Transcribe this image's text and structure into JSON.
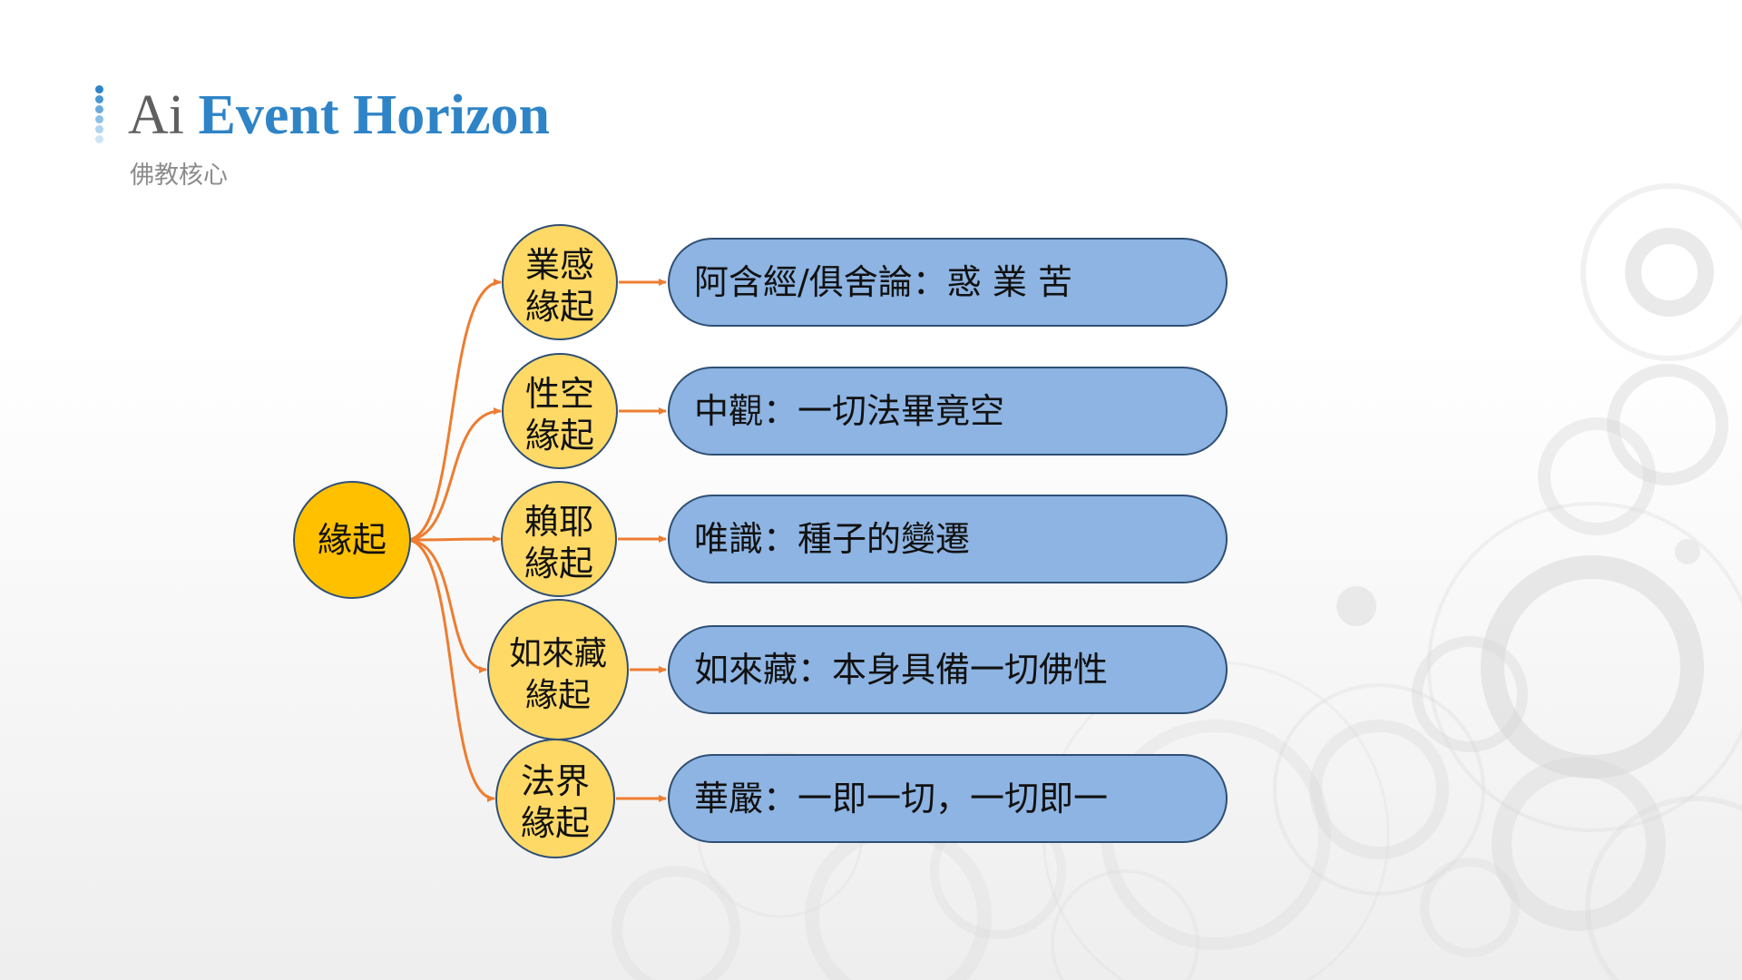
{
  "header": {
    "title_prefix": "Ai",
    "title_main": "Event Horizon",
    "subtitle": "佛教核心"
  },
  "colors": {
    "title_gray": "#5f5f5f",
    "title_blue": "#2e84c6",
    "root_fill": "#ffc000",
    "node_fill": "#ffd966",
    "box_fill": "#8db4e2",
    "stroke": "#2f4f74",
    "connector": "#ed7d31"
  },
  "diagram": {
    "root": {
      "label": "緣起"
    },
    "branches": [
      {
        "node_line1": "業感",
        "node_line2": "緣起",
        "description": "阿含經/俱舍論：惑 業 苦"
      },
      {
        "node_line1": "性空",
        "node_line2": "緣起",
        "description": "中觀：一切法畢竟空"
      },
      {
        "node_line1": "賴耶",
        "node_line2": "緣起",
        "description": "唯識：種子的變遷"
      },
      {
        "node_line1": "如來藏",
        "node_line2": "緣起",
        "description": "如來藏：本身具備一切佛性"
      },
      {
        "node_line1": "法界",
        "node_line2": "緣起",
        "description": "華嚴：一即一切，一切即一"
      }
    ]
  }
}
